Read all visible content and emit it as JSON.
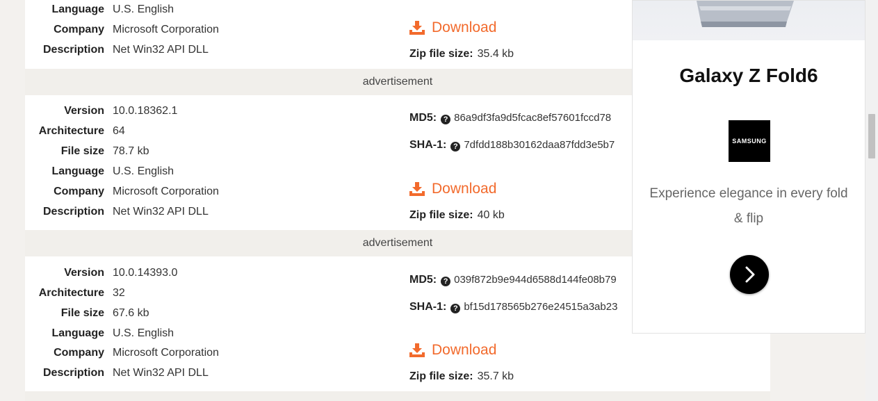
{
  "labels": {
    "version": "Version",
    "architecture": "Architecture",
    "file_size": "File size",
    "language": "Language",
    "company": "Company",
    "description": "Description",
    "md5": "MD5:",
    "sha1": "SHA-1:",
    "download": "Download",
    "zip_file_size": "Zip file size:",
    "advertisement": "advertisement"
  },
  "files": [
    {
      "language": "U.S. English",
      "company": "Microsoft Corporation",
      "description": "Net Win32 API DLL",
      "zip_size": "35.4 kb"
    },
    {
      "version": "10.0.18362.1",
      "architecture": "64",
      "file_size": "78.7 kb",
      "language": "U.S. English",
      "company": "Microsoft Corporation",
      "description": "Net Win32 API DLL",
      "md5": "86a9df3fa9d5fcac8ef57601fccd78",
      "sha1": "7dfdd188b30162daa87fdd3e5b7",
      "zip_size": "40 kb"
    },
    {
      "version": "10.0.14393.0",
      "architecture": "32",
      "file_size": "67.6 kb",
      "language": "U.S. English",
      "company": "Microsoft Corporation",
      "description": "Net Win32 API DLL",
      "md5": "039f872b9e944d6588d144fe08b79",
      "sha1": "bf15d178565b276e24515a3ab23",
      "zip_size": "35.7 kb"
    }
  ],
  "ad": {
    "title": "Galaxy Z Fold6",
    "brand": "SAMSUNG",
    "text": "Experience elegance in every fold & flip",
    "cta_icon": "chevron-right-icon"
  },
  "colors": {
    "accent": "#f26a2c",
    "ad_bar": "#f1efeb"
  }
}
